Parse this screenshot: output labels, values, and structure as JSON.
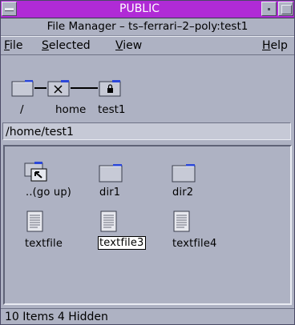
{
  "window": {
    "title": "PUBLIC",
    "subtitle": "File Manager – ts–ferrari–2–poly:test1"
  },
  "menubar": {
    "file": {
      "mnemonic": "F",
      "rest": "ile"
    },
    "selected": {
      "mnemonic": "S",
      "rest": "elected"
    },
    "view": {
      "mnemonic": "V",
      "rest": "iew"
    },
    "help": {
      "mnemonic": "H",
      "rest": "elp"
    }
  },
  "path_icons": [
    {
      "label": "/",
      "icon": "folder-icon"
    },
    {
      "label": "home",
      "icon": "folder-restricted-icon"
    },
    {
      "label": "test1",
      "icon": "folder-locked-icon"
    }
  ],
  "path_field": {
    "value": "/home/test1"
  },
  "files": [
    {
      "label": "..(go up)",
      "icon": "folder-up-icon",
      "selected": false
    },
    {
      "label": "dir1",
      "icon": "folder-icon",
      "selected": false
    },
    {
      "label": "dir2",
      "icon": "folder-icon",
      "selected": false
    },
    {
      "label": "textfile",
      "icon": "text-file-icon",
      "selected": false
    },
    {
      "label": "textfile3",
      "icon": "text-file-icon",
      "selected": true
    },
    {
      "label": "textfile4",
      "icon": "text-file-icon",
      "selected": false
    }
  ],
  "status": {
    "text": "10 Items 4 Hidden"
  },
  "colors": {
    "titlebar": "#b02bd6",
    "window_bg": "#aeb2c3",
    "folder_tab": "#2b47d9"
  }
}
